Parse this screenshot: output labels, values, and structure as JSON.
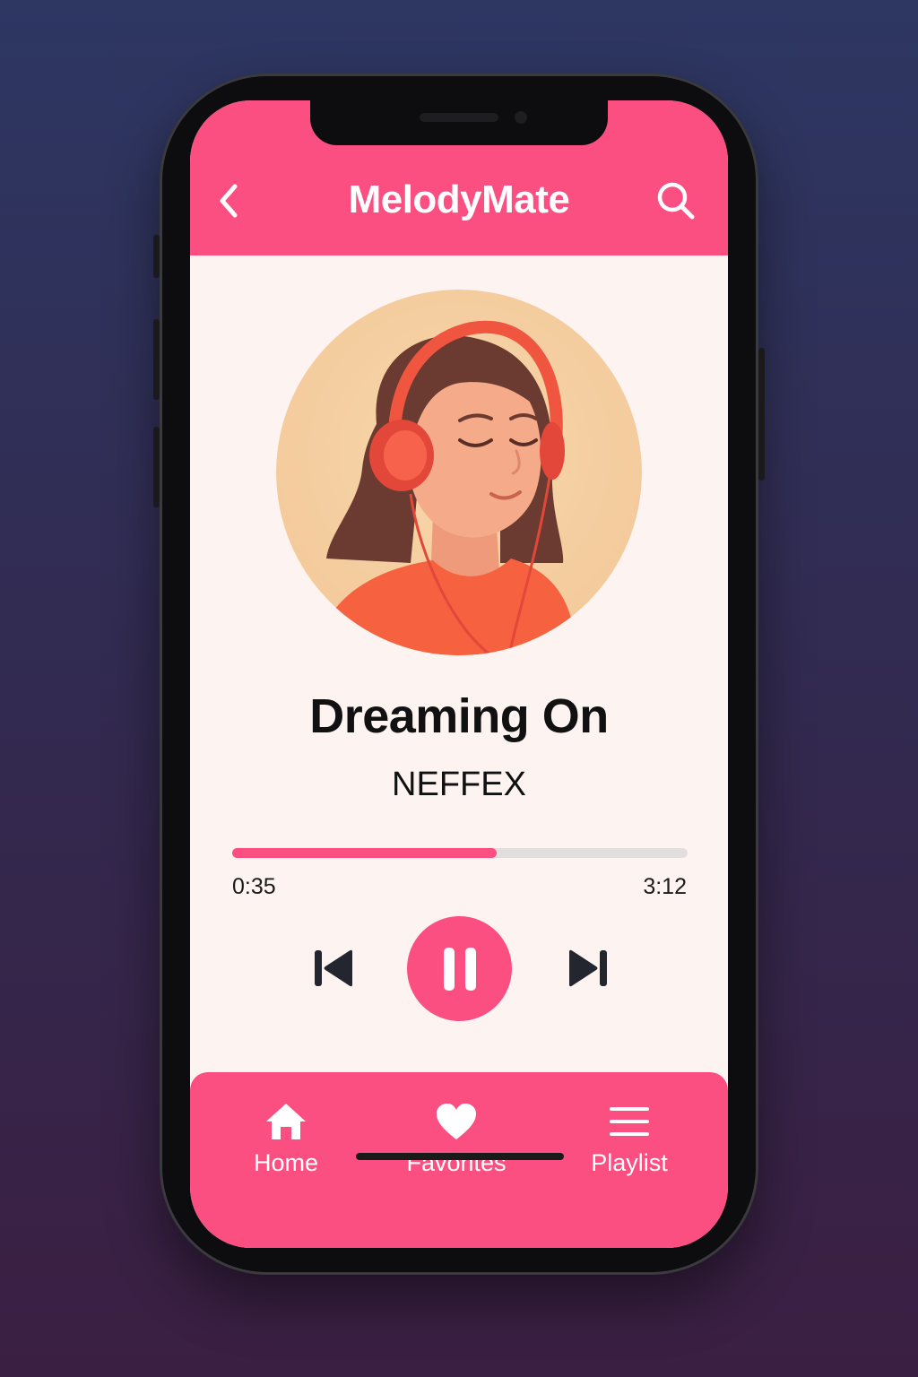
{
  "app": {
    "title": "MelodyMate"
  },
  "header": {
    "back_icon": "chevron-left-icon",
    "search_icon": "search-icon"
  },
  "now_playing": {
    "title": "Dreaming On",
    "artist": "NEFFEX",
    "elapsed": "0:35",
    "duration": "3:12",
    "progress_fraction": 0.58,
    "state": "playing"
  },
  "controls": {
    "previous_icon": "skip-previous-icon",
    "pause_icon": "pause-icon",
    "next_icon": "skip-next-icon"
  },
  "bottom_nav": {
    "items": [
      {
        "label": "Home",
        "icon": "home-icon"
      },
      {
        "label": "Favorites",
        "icon": "heart-icon"
      },
      {
        "label": "Playlist",
        "icon": "menu-icon"
      }
    ]
  },
  "colors": {
    "accent": "#fb4f82",
    "screen_bg": "#fdf4f2",
    "page_bg_top": "#2d3762",
    "page_bg_bottom": "#3b1f42",
    "text": "#111111"
  }
}
